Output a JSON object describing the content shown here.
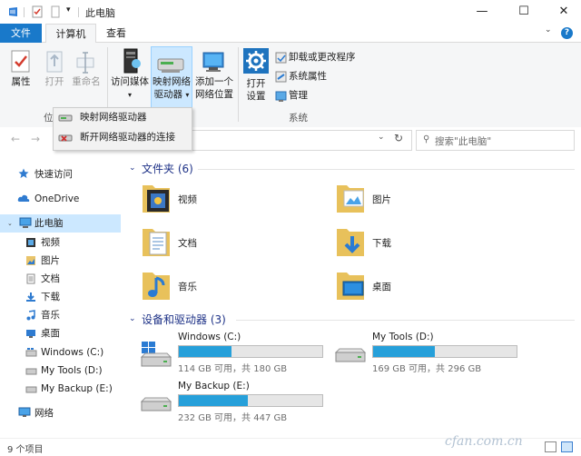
{
  "window": {
    "title": "此电脑",
    "minimize": "—",
    "maximize": "☐",
    "close": "✕"
  },
  "tabs": {
    "file": "文件",
    "computer": "计算机",
    "view": "查看"
  },
  "ribbon": {
    "properties": "属性",
    "open": "打开",
    "rename": "重命名",
    "access_media_line1": "访问媒体",
    "map_drive_line1": "映射网络",
    "map_drive_line2": "驱动器",
    "add_location_line1": "添加一个",
    "add_location_line2": "网络位置",
    "open_settings_line1": "打开",
    "open_settings_line2": "设置",
    "uninstall": "卸载或更改程序",
    "system_props": "系统属性",
    "manage": "管理",
    "group_location_partial": "位",
    "group_system": "系统"
  },
  "dropdown": {
    "map": "映射网络驱动器",
    "disconnect": "断开网络驱动器的连接"
  },
  "address": {
    "search_placeholder": "搜索\"此电脑\""
  },
  "nav": {
    "quick_access": "快速访问",
    "onedrive": "OneDrive",
    "this_pc": "此电脑",
    "videos": "视频",
    "pictures": "图片",
    "documents": "文档",
    "downloads": "下载",
    "music": "音乐",
    "desktop": "桌面",
    "drive_c": "Windows (C:)",
    "drive_d": "My Tools (D:)",
    "drive_e": "My Backup (E:)",
    "network": "网络"
  },
  "folders_section": "文件夹 (6)",
  "folders": {
    "videos": "视频",
    "pictures": "图片",
    "documents": "文档",
    "downloads": "下载",
    "music": "音乐",
    "desktop": "桌面"
  },
  "drives_section": "设备和驱动器 (3)",
  "drives": [
    {
      "name": "Windows (C:)",
      "info": "114 GB 可用，共 180 GB",
      "used_fraction": 0.367
    },
    {
      "name": "My Tools (D:)",
      "info": "169 GB 可用，共 296 GB",
      "used_fraction": 0.429
    },
    {
      "name": "My Backup (E:)",
      "info": "232 GB 可用，共 447 GB",
      "used_fraction": 0.481
    }
  ],
  "status": {
    "count": "9 个项目"
  },
  "watermark": "cfan.com.cn",
  "colors": {
    "accent": "#1979ca",
    "drive_bar": "#26a0da",
    "selection": "#cce8ff",
    "section_title": "#1e3287"
  }
}
